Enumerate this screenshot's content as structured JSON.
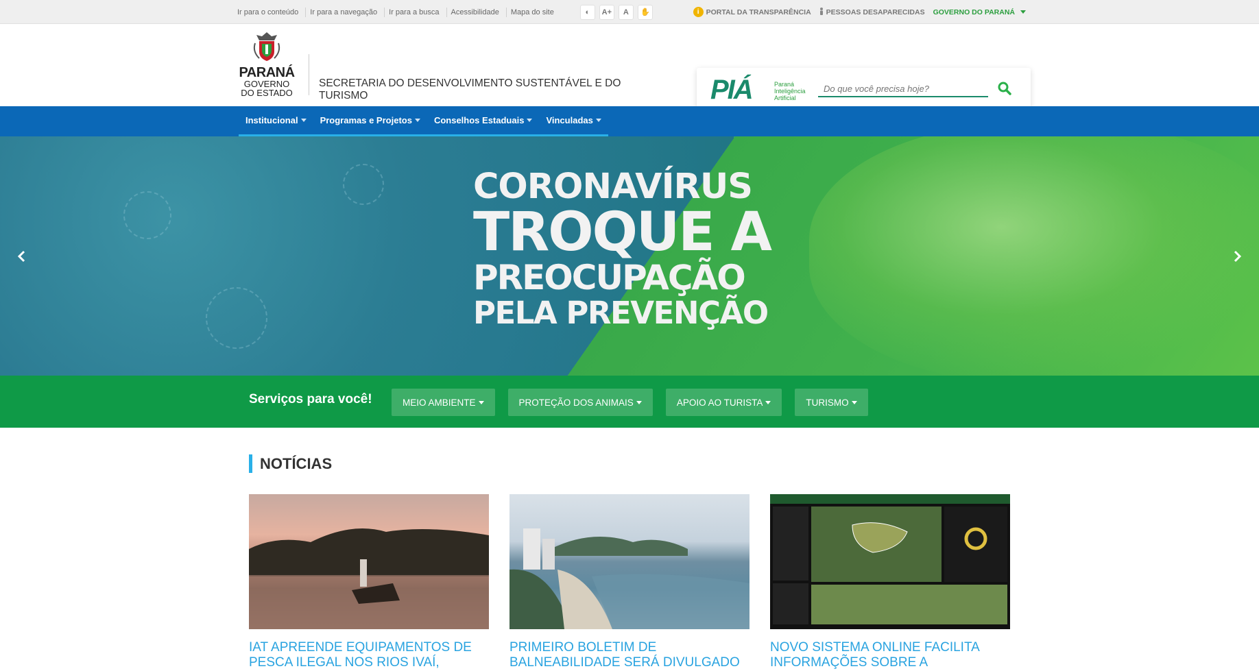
{
  "topbar": {
    "skip_links": [
      "Ir para o conteúdo",
      "Ir para a navegação",
      "Ir para a busca",
      "Acessibilidade",
      "Mapa do site"
    ],
    "a11y": {
      "contrast": "◐",
      "font_increase": "A+",
      "font_reset": "A",
      "libras": "✋"
    },
    "transparency": "PORTAL DA TRANSPARÊNCIA",
    "missing_people": "PESSOAS DESAPARECIDAS",
    "gov": "GOVERNO DO PARANÁ"
  },
  "header": {
    "logo": {
      "state": "PARANÁ",
      "line1": "GOVERNO",
      "line2": "DO ESTADO"
    },
    "secretaria": "SECRETARIA DO DESENVOLVIMENTO SUSTENTÁVEL E DO TURISMO",
    "pia": {
      "logo": "PIÁ",
      "sub1": "Paraná",
      "sub2": "Inteligência",
      "sub3": "Artificial"
    },
    "search_placeholder": "Do que você precisa hoje?"
  },
  "nav": [
    "Institucional",
    "Programas e Projetos",
    "Conselhos Estaduais",
    "Vinculadas"
  ],
  "hero": {
    "line1": "CORONAVÍRUS",
    "line2": "TROQUE A",
    "line3": "PREOCUPAÇÃO",
    "line4": "PELA PREVENÇÃO"
  },
  "services": {
    "title": "Serviços para você!",
    "buttons": [
      "MEIO AMBIENTE",
      "PROTEÇÃO DOS ANIMAIS",
      "APOIO AO TURISTA",
      "TURISMO"
    ]
  },
  "news": {
    "heading": "NOTÍCIAS",
    "items": [
      {
        "title": "IAT APREENDE EQUIPAMENTOS DE PESCA ILEGAL NOS RIOS IVAÍ,"
      },
      {
        "title": "PRIMEIRO BOLETIM DE BALNEABILIDADE SERÁ DIVULGADO"
      },
      {
        "title": "NOVO SISTEMA ONLINE FACILITA INFORMAÇÕES SOBRE A"
      }
    ]
  },
  "colors": {
    "nav_blue": "#0b68b7",
    "services_green": "#0f9a47",
    "accent_cyan": "#29b0e8",
    "news_title": "#29a3e0"
  }
}
